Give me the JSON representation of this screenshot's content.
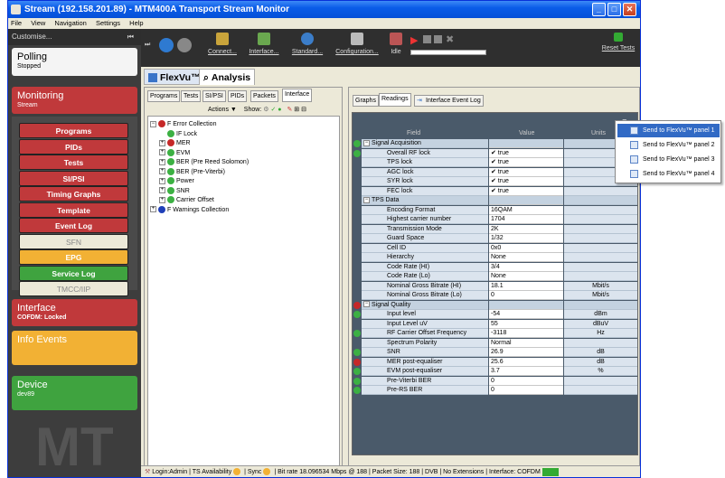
{
  "window": {
    "title": "Stream (192.158.201.89) - MTM400A Transport Stream Monitor"
  },
  "menu": [
    "File",
    "View",
    "Navigation",
    "Settings",
    "Help"
  ],
  "sidebar": {
    "customise_label": "Customise...",
    "polling": {
      "title": "Polling",
      "status": "Stopped"
    },
    "monitoring": {
      "title": "Monitoring",
      "sub": "Stream"
    },
    "nav": [
      {
        "label": "Programs",
        "color": "#c0393b"
      },
      {
        "label": "PIDs",
        "color": "#c0393b"
      },
      {
        "label": "Tests",
        "color": "#c0393b"
      },
      {
        "label": "SI/PSI",
        "color": "#c0393b"
      },
      {
        "label": "Timing Graphs",
        "color": "#c0393b"
      },
      {
        "label": "Template",
        "color": "#c0393b"
      },
      {
        "label": "Event Log",
        "color": "#c0393b"
      },
      {
        "label": "SFN",
        "color": "#ece9d8"
      },
      {
        "label": "EPG",
        "color": "#f2b134"
      },
      {
        "label": "Service Log",
        "color": "#3fa33f"
      },
      {
        "label": "TMCC/IIP",
        "color": "#ece9d8"
      }
    ],
    "interface": {
      "title": "Interface",
      "sub": "COFDM: Locked"
    },
    "info_events": {
      "title": "Info Events"
    },
    "device": {
      "title": "Device",
      "sub": "dev89"
    }
  },
  "toolbar": {
    "connect": "Connect...",
    "interface": "Interface...",
    "standard": "Standard...",
    "configuration": "Configuration...",
    "idle": "Idle",
    "reset": "Reset Tests"
  },
  "tabs": {
    "flexvu": "FlexVu™",
    "analysis": "Analysis"
  },
  "left_tabs": [
    "Programs",
    "Tests",
    "SI/PSI",
    "PIDs",
    "Packets",
    "Interface"
  ],
  "tree_toolbar": {
    "actions": "Actions ▼",
    "show": "Show:"
  },
  "tree": [
    {
      "label": "F Error Collection",
      "color": "#c62828"
    },
    {
      "label": "IF Lock",
      "color": "#3cb043"
    },
    {
      "label": "MER",
      "color": "#c62828"
    },
    {
      "label": "EVM",
      "color": "#3cb043"
    },
    {
      "label": "BER (Pre Reed Solomon)",
      "color": "#3cb043"
    },
    {
      "label": "BER (Pre-Viterbi)",
      "color": "#3cb043"
    },
    {
      "label": "Power",
      "color": "#3cb043"
    },
    {
      "label": "SNR",
      "color": "#3cb043"
    },
    {
      "label": "Carrier Offset",
      "color": "#3cb043"
    },
    {
      "label": "F Warnings Collection",
      "color": "#1f3fb8"
    }
  ],
  "right_tabs": [
    "Graphs",
    "Readings",
    "Interface Event Log"
  ],
  "grid": {
    "headers": [
      "Field",
      "Value",
      "Units"
    ],
    "rows": [
      {
        "field": "Signal Acquisition",
        "value": "",
        "units": "",
        "group": true,
        "status": "#3cb043"
      },
      {
        "field": "Overall RF lock",
        "value": "✔ true",
        "units": "",
        "status": "#3cb043"
      },
      {
        "field": "TPS lock",
        "value": "✔ true",
        "units": ""
      },
      {
        "field": "AGC lock",
        "value": "✔ true",
        "units": ""
      },
      {
        "field": "SYR lock",
        "value": "✔ true",
        "units": ""
      },
      {
        "field": "FEC lock",
        "value": "✔ true",
        "units": ""
      },
      {
        "field": "TPS Data",
        "value": "",
        "units": "",
        "group": true
      },
      {
        "field": "Encoding Format",
        "value": "16QAM",
        "units": ""
      },
      {
        "field": "Highest carrier number",
        "value": "1704",
        "units": ""
      },
      {
        "field": "Transmission Mode",
        "value": "2K",
        "units": ""
      },
      {
        "field": "Guard Space",
        "value": "1/32",
        "units": ""
      },
      {
        "field": "Cell ID",
        "value": "0x0",
        "units": ""
      },
      {
        "field": "Hierarchy",
        "value": "None",
        "units": ""
      },
      {
        "field": "Code Rate (HI)",
        "value": "3/4",
        "units": ""
      },
      {
        "field": "Code Rate (Lo)",
        "value": "None",
        "units": ""
      },
      {
        "field": "Nominal Gross Bitrate (HI)",
        "value": "18.1",
        "units": "Mbit/s"
      },
      {
        "field": "Nominal Gross Bitrate (Lo)",
        "value": "0",
        "units": "Mbit/s"
      },
      {
        "field": "Signal Quality",
        "value": "",
        "units": "",
        "group": true,
        "status": "#c62828"
      },
      {
        "field": "Input level",
        "value": "-54",
        "units": "dBm",
        "status": "#3cb043"
      },
      {
        "field": "Input Level uV",
        "value": "55",
        "units": "dBuV"
      },
      {
        "field": "RF Carrier Offset Frequency",
        "value": "-3118",
        "units": "Hz",
        "status": "#3cb043"
      },
      {
        "field": "Spectrum Polarity",
        "value": "Normal",
        "units": ""
      },
      {
        "field": "SNR",
        "value": "26.9",
        "units": "dB",
        "status": "#3cb043"
      },
      {
        "field": "MER post-equaliser",
        "value": "25.6",
        "units": "dB",
        "status": "#c62828"
      },
      {
        "field": "EVM post-equaliser",
        "value": "3.7",
        "units": "%",
        "status": "#3cb043"
      },
      {
        "field": "Pre-Viterbi BER",
        "value": "0",
        "units": "",
        "status": "#3cb043"
      },
      {
        "field": "Pre-RS BER",
        "value": "0",
        "units": "",
        "status": "#3cb043"
      }
    ]
  },
  "context_menu": [
    "Send to FlexVu™ panel 1",
    "Send to FlexVu™ panel 2",
    "Send to FlexVu™ panel 3",
    "Send to FlexVu™ panel 4"
  ],
  "status": {
    "login": "Login:Admin",
    "ts": "TS Availability",
    "sync": "Sync",
    "bitrate": "Bit rate 18.096534 Mbps @ 188",
    "packet": "Packet Size: 188",
    "dvb": "DVB",
    "ext": "No Extensions",
    "iface": "Interface: COFDM"
  }
}
